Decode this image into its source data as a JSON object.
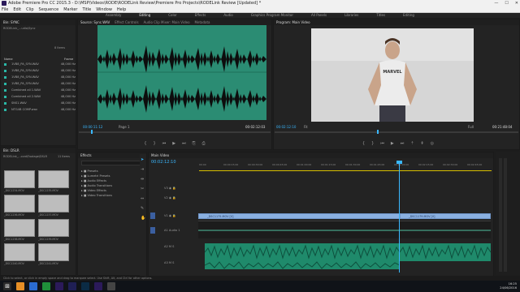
{
  "window": {
    "title": "Adobe Premiere Pro CC 2015.3 - D:\\MSP\\Videos\\RODE\\RODELink Review\\Premiere Pro Projects\\RODELink Review [Updated] *",
    "controls": [
      "—",
      "☐",
      "✕"
    ]
  },
  "menu": [
    "File",
    "Edit",
    "Clip",
    "Sequence",
    "Marker",
    "Title",
    "Window",
    "Help"
  ],
  "workspaces": [
    {
      "label": "Assembly",
      "active": false
    },
    {
      "label": "Editing",
      "active": true
    },
    {
      "label": "Color",
      "active": false
    },
    {
      "label": "Effects",
      "active": false
    },
    {
      "label": "Audio",
      "active": false
    },
    {
      "label": "Graphics Program Monitor",
      "active": false
    },
    {
      "label": "All Panels",
      "active": false
    },
    {
      "label": "Libraries",
      "active": false
    },
    {
      "label": "Titles",
      "active": false
    },
    {
      "label": "Editing",
      "active": false
    }
  ],
  "project_panel": {
    "tab": "Bin: SYNC",
    "path": "RODELink_...udio\\Sync",
    "items_count": "8 Items",
    "col_name": "Name",
    "col_rate": "Frame",
    "items": [
      {
        "name": "1VB8_PA_SYN.WAV",
        "rate": "48,000 Hz"
      },
      {
        "name": "1VB8_PA_SYN.WAV",
        "rate": "48,000 Hz"
      },
      {
        "name": "1VB8_PA_SYN.WAV",
        "rate": "48,000 Hz"
      },
      {
        "name": "1VB8_PA_SYN.WAV",
        "rate": "48,000 Hz"
      },
      {
        "name": "Combined all 1.WAV",
        "rate": "48,000 Hz"
      },
      {
        "name": "Combined all 2.WAV",
        "rate": "48,000 Hz"
      },
      {
        "name": "SNS1.WAV",
        "rate": "48,000 Hz"
      },
      {
        "name": "NTG4B COMP.wav",
        "rate": "48,000 Hz"
      }
    ]
  },
  "bin2": {
    "tab": "Bin: DSLR",
    "path": "RODELink_...cord\\Footage\\DSLR",
    "count": "11 Items",
    "thumbs": [
      {
        "label": "_DSC1234.MOV"
      },
      {
        "label": "_DSC1235.MOV"
      },
      {
        "label": "_DSC1236.MOV"
      },
      {
        "label": "_DSC1237.MOV"
      },
      {
        "label": "_DSC1238.MOV"
      },
      {
        "label": "_DSC1239.MOV"
      },
      {
        "label": "_DSC1240.MOV"
      },
      {
        "label": "_DSC1241.MOV"
      }
    ]
  },
  "effects_panel": {
    "tab": "Effects",
    "items": [
      "Presets",
      "Lumetri Presets",
      "Audio Effects",
      "Audio Transitions",
      "Video Effects",
      "Video Transitions"
    ]
  },
  "source_monitor": {
    "tabs": [
      "Source: Sync.WAV",
      "Effect Controls",
      "Audio Clip Mixer: Main Video",
      "Metadata"
    ],
    "timecode_in": "00:00:11:12",
    "page": "Page 1",
    "timecode_out": "00:02:12:03"
  },
  "program_monitor": {
    "tab": "Program: Main Video",
    "timecode": "00:02:12:10",
    "fit": "Fit",
    "quality": "Full",
    "duration": "00:21:48:04",
    "shirt_text": "MARVEL"
  },
  "timeline": {
    "tab": "Main Video",
    "timecode": "00:02:12:10",
    "ruler": [
      "00:00",
      "00:00:15:00",
      "00:00:30:00",
      "00:00:45:00",
      "00:01:00:00",
      "00:01:15:00",
      "00:01:30:00",
      "00:01:45:00",
      "00:02:00:00",
      "00:02:15:00",
      "00:02:30:00",
      "00:02:45:00"
    ],
    "tracks": [
      "V3",
      "V2",
      "V1",
      "A1",
      "A2",
      "A3"
    ],
    "clip1": "_DSC1175.MOV [V]",
    "clip2": "_DSC1179.MOV [V]",
    "audio_label": "Audio 1"
  },
  "status_text": "Click to select, or click in empty space and drag to marquee select. Use Shift, Alt, and Ctrl for other options.",
  "clock": {
    "time": "16:25",
    "date": "24/06/2016"
  },
  "colors": {
    "audio_green": "#2b8c73",
    "clip_blue": "#8ab0e0",
    "timecode_blue": "#3ab8ff",
    "playhead": "#3ab8ff"
  }
}
